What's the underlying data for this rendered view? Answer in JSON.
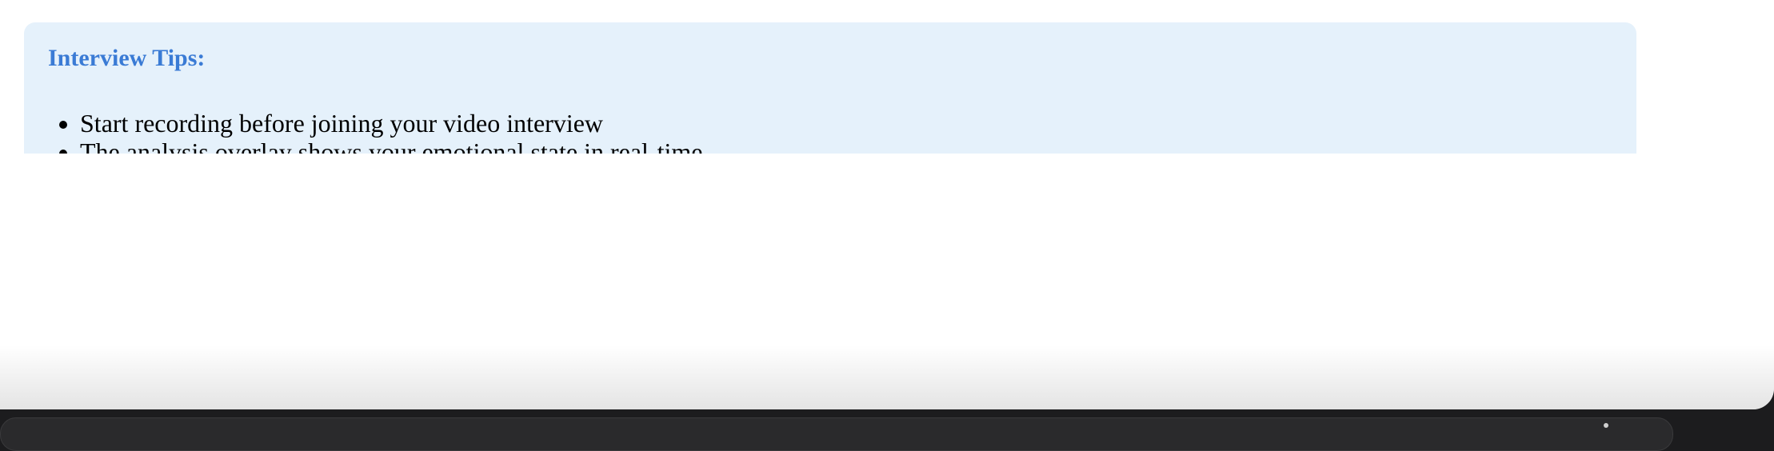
{
  "tips": {
    "title": "Interview Tips:",
    "items": [
      "Start recording before joining your video interview",
      "The analysis overlay shows your emotional state in real-time"
    ]
  },
  "colors": {
    "card_background": "#e5f1fb",
    "title_color": "#3a7bd5",
    "dock_background": "#1c1c1e"
  }
}
